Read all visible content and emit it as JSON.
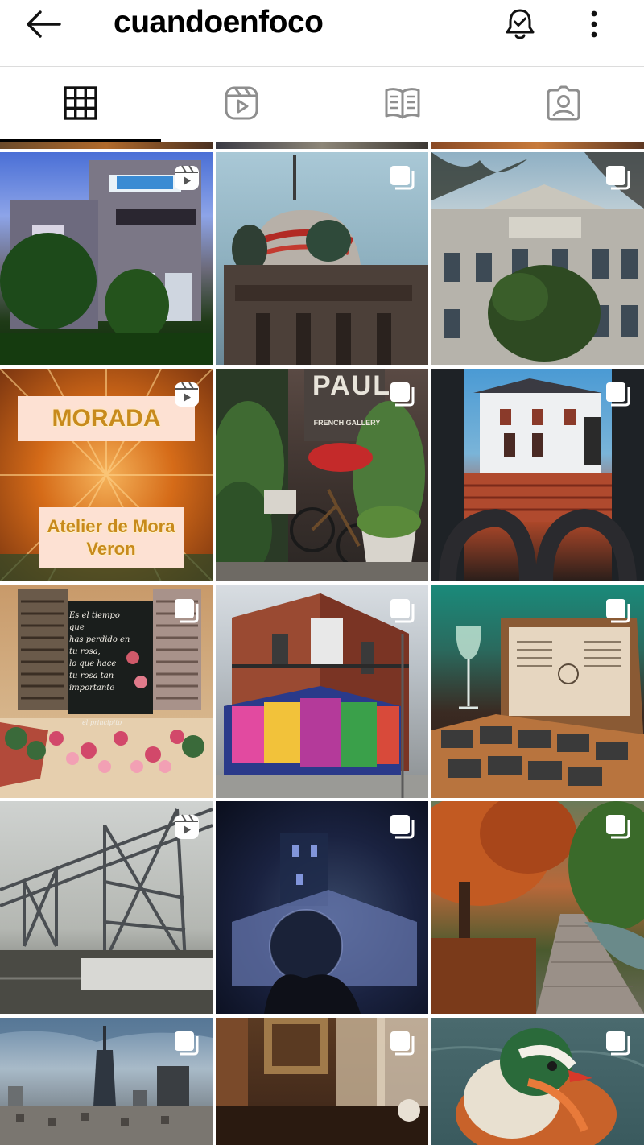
{
  "header": {
    "title": "cuandoenfoco",
    "back_icon": "arrow-left-icon",
    "bell_icon": "bell-check-icon",
    "more_icon": "more-vertical-icon"
  },
  "tabs": [
    {
      "name": "grid",
      "icon": "grid-icon",
      "active": true
    },
    {
      "name": "reels",
      "icon": "reels-icon",
      "active": false
    },
    {
      "name": "guides",
      "icon": "guide-book-icon",
      "active": false
    },
    {
      "name": "tagged",
      "icon": "tagged-person-icon",
      "active": false
    }
  ],
  "posts": [
    {
      "type": "reel",
      "subject": "house with sign"
    },
    {
      "type": "multi",
      "subject": "dome tower"
    },
    {
      "type": "multi",
      "subject": "classic building"
    },
    {
      "type": "reel",
      "subject": "Morada poster",
      "text_top": "MORADA",
      "text_bottom": "Atelier de Mora Veron"
    },
    {
      "type": "multi",
      "subject": "Paul storefront with bicycle",
      "sign_text": "PAUL",
      "sign_sub": "FRENCH GALLERY"
    },
    {
      "type": "multi",
      "subject": "white house stairs"
    },
    {
      "type": "multi",
      "subject": "chalkboard window",
      "board_lines": [
        "Es el tiempo que",
        "has perdido en tu rosa,",
        "lo que hace",
        "tu rosa tan",
        "importante"
      ],
      "board_sign": "el principito"
    },
    {
      "type": "multi",
      "subject": "mural corner building"
    },
    {
      "type": "multi",
      "subject": "wine glass and tasting box"
    },
    {
      "type": "reel",
      "subject": "transporter bridge"
    },
    {
      "type": "multi",
      "subject": "night crystal ball"
    },
    {
      "type": "multi",
      "subject": "autumn path"
    },
    {
      "type": "multi",
      "subject": "city skyline"
    },
    {
      "type": "multi",
      "subject": "cafe interior"
    },
    {
      "type": "multi",
      "subject": "mandarin duck"
    }
  ],
  "colors": {
    "text": "#000000",
    "divider": "#dcdcdc",
    "tab_inactive": "#8e8e8e"
  }
}
